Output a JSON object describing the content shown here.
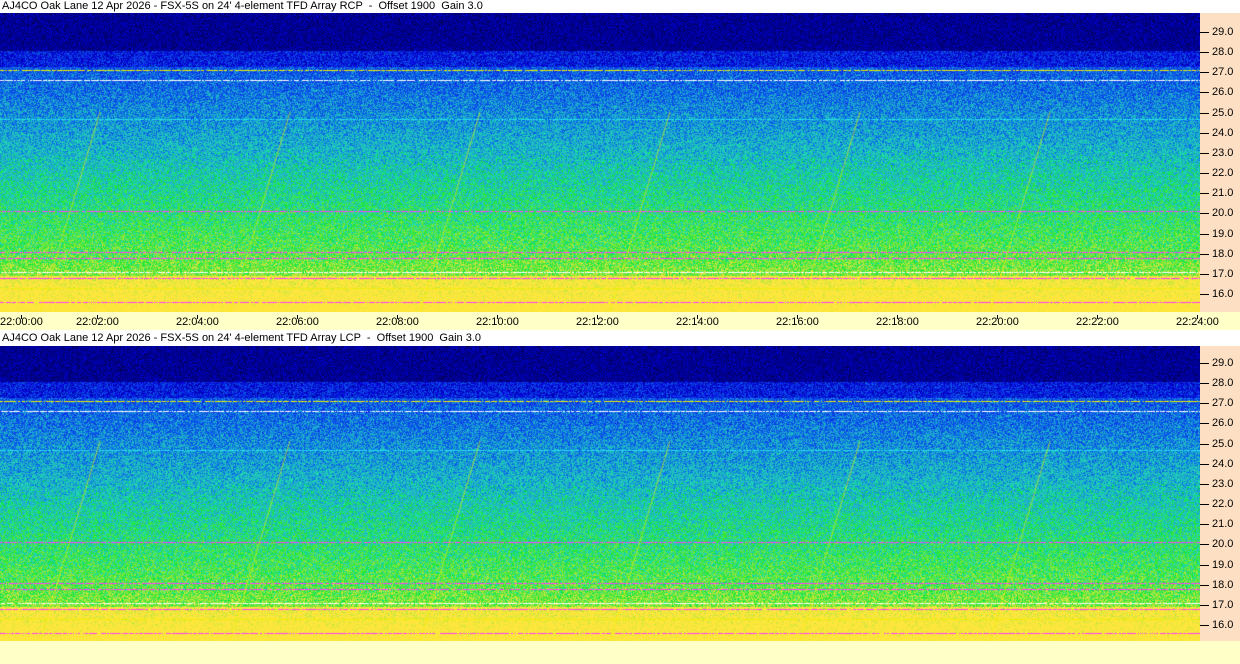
{
  "panels": [
    {
      "title": "AJ4CO Oak Lane 12 Apr 2026 - FSX-5S on 24' 4-element TFD Array RCP  -  Offset 1900  Gain 3.0",
      "polarization": "RCP"
    },
    {
      "title": "AJ4CO Oak Lane 12 Apr 2026 - FSX-5S on 24' 4-element TFD Array LCP  -  Offset 1900  Gain 3.0",
      "polarization": "LCP"
    }
  ],
  "frequency_ticks": [
    "16.0",
    "17.0",
    "18.0",
    "19.0",
    "20.0",
    "21.0",
    "22.0",
    "23.0",
    "24.0",
    "25.0",
    "26.0",
    "27.0",
    "28.0",
    "29.0"
  ],
  "time_ticks": [
    "22:00:00",
    "22:02:00",
    "22:04:00",
    "22:06:00",
    "22:08:00",
    "22:10:00",
    "22:12:00",
    "22:14:00",
    "22:16:00",
    "22:18:00",
    "22:20:00",
    "22:22:00",
    "22:24:00"
  ],
  "colors": {
    "axis_bg": "#fde0c4",
    "time_bg": "#ffffc8",
    "low_signal": "#000040",
    "mid_signal": "#1060e0",
    "high_signal": "#f0f000",
    "interference": "#ff40ff"
  }
}
